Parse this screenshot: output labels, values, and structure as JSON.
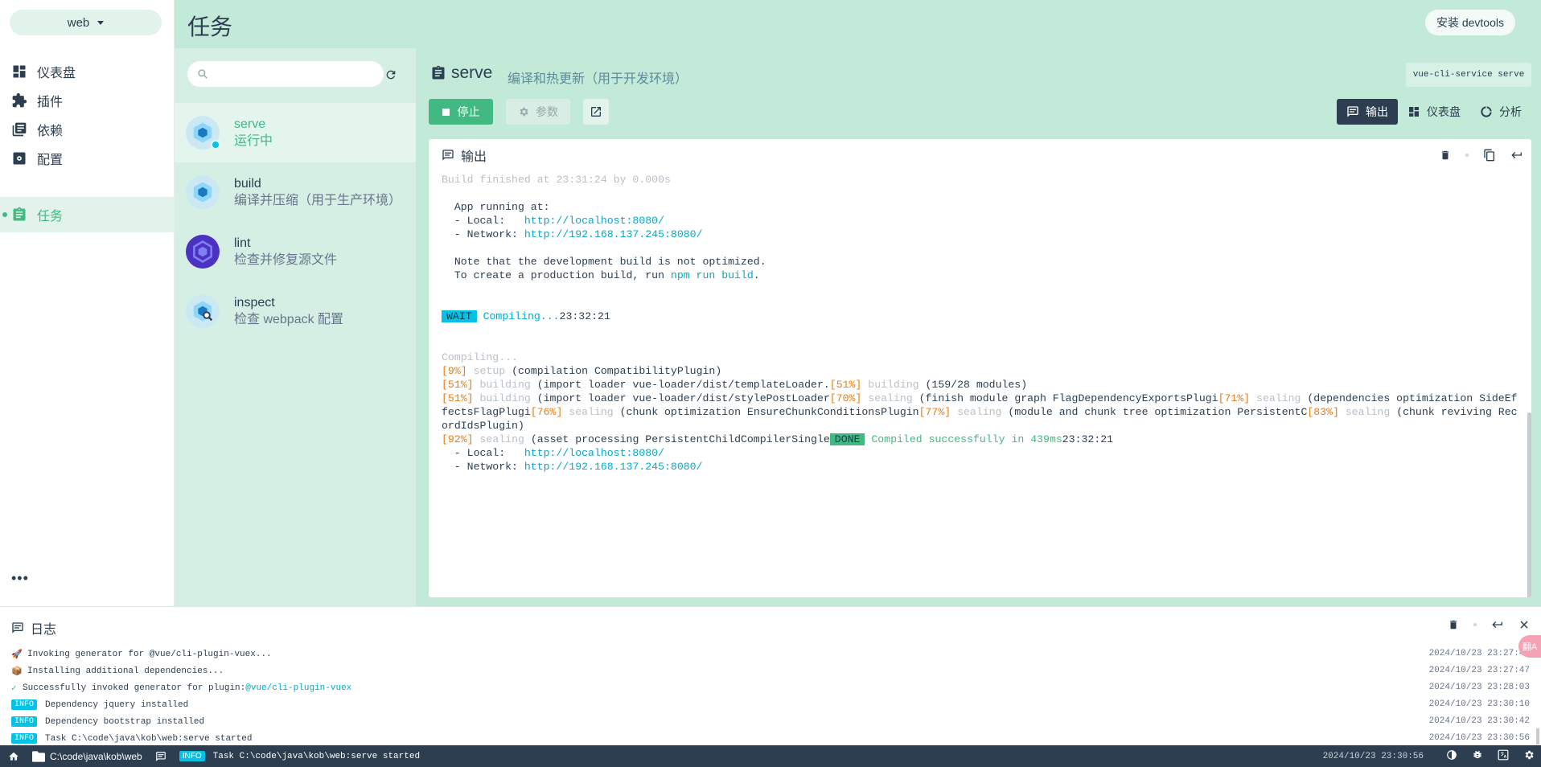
{
  "app": {
    "project": "web",
    "page_title": "任务",
    "devtools_label": "安装 devtools"
  },
  "nav": {
    "items": [
      {
        "label": "仪表盘",
        "icon": "dashboard-icon"
      },
      {
        "label": "插件",
        "icon": "puzzle-icon"
      },
      {
        "label": "依赖",
        "icon": "library-icon"
      },
      {
        "label": "配置",
        "icon": "settings-icon"
      },
      {
        "label": "任务",
        "icon": "assignment-icon",
        "active": true
      }
    ],
    "more": "•••"
  },
  "search": {
    "placeholder": "",
    "value": ""
  },
  "tasks": [
    {
      "name": "serve",
      "desc": "运行中",
      "selected": true
    },
    {
      "name": "build",
      "desc": "编译并压缩（用于生产环境）"
    },
    {
      "name": "lint",
      "desc": "检查并修复源文件"
    },
    {
      "name": "inspect",
      "desc": "检查 webpack 配置"
    }
  ],
  "detail": {
    "title": "serve",
    "desc": "编译和热更新（用于开发环境）",
    "command": "vue-cli-service serve",
    "stop_label": "停止",
    "params_label": "参数",
    "views": [
      {
        "label": "输出",
        "active": true
      },
      {
        "label": "仪表盘"
      },
      {
        "label": "分析"
      }
    ],
    "output_title": "输出"
  },
  "terminal": {
    "build_finished": "Build finished at 23:31:24 by 0.000s",
    "app_running": "App running at:",
    "local_label": "- Local:   ",
    "local_url": "http://localhost:8080/",
    "network_label": "- Network: ",
    "network_url": "http://192.168.137.245:8080/",
    "note1": "Note that the development build is not optimized.",
    "note2_pre": "To create a production build, run ",
    "note2_cmd": "npm run build",
    "note2_post": ".",
    "wait_tag": "WAIT",
    "compiling_text": "Compiling...",
    "compiling_time": "23:32:21",
    "compiling_dim": "Compiling...",
    "p9_pct": "[9%]",
    "p9_stage": "setup",
    "p9_rest": "(compilation CompatibilityPlugin)",
    "p51a_pct": "[51%]",
    "p51a_stage": "building",
    "p51a_rest": "(import loader vue-loader/dist/templateLoader.",
    "p51a_pct2": "[51%]",
    "p51a_stage2": "building",
    "p51a_rest2": "(159/28 modules)",
    "p51b_pct": "[51%]",
    "p51b_stage": "building",
    "p51b_rest": "(import loader vue-loader/dist/stylePostLoader",
    "p70_pct": "[70%]",
    "p70_stage": "sealing",
    "p70_rest": "(finish module graph FlagDependencyExportsPlugi",
    "p71_pct": "[71%]",
    "p71_stage": "sealing",
    "p71_rest": "(dependencies optimization SideEffectsFlagPlugi",
    "p76_pct": "[76%]",
    "p76_stage": "sealing",
    "p76_rest": "(chunk optimization EnsureChunkConditionsPlugin",
    "p77_pct": "[77%]",
    "p77_stage": "sealing",
    "p77_rest": "(module and chunk tree optimization PersistentC",
    "p83_pct": "[83%]",
    "p83_stage": "sealing",
    "p83_rest": "(chunk reviving RecordIdsPlugin)",
    "p92_pct": "[92%]",
    "p92_stage": "sealing",
    "p92_rest": "(asset processing PersistentChildCompilerSingle",
    "done_tag": "DONE",
    "done_text": "Compiled successfully in 439ms",
    "done_time": "23:32:21"
  },
  "log": {
    "title": "日志",
    "lines": [
      {
        "glyph": "🚀",
        "text": "Invoking generator for @vue/cli-plugin-vuex...",
        "time": "2024/10/23 23:27:47"
      },
      {
        "glyph": "📦",
        "text": "Installing additional dependencies...",
        "time": "2024/10/23 23:27:47"
      },
      {
        "glyph": "✓",
        "text": "Successfully invoked generator for plugin: ",
        "link": "@vue/cli-plugin-vuex",
        "time": "2024/10/23 23:28:03"
      },
      {
        "tag": "INFO",
        "text": "Dependency jquery installed",
        "time": "2024/10/23 23:30:10"
      },
      {
        "tag": "INFO",
        "text": "Dependency bootstrap installed",
        "time": "2024/10/23 23:30:42"
      },
      {
        "tag": "INFO",
        "text": "Task C:\\code\\java\\kob\\web:serve started",
        "time": "2024/10/23 23:30:56"
      }
    ]
  },
  "status_bar": {
    "path": "C:\\code\\java\\kob\\web",
    "info_tag": "INFO",
    "message": "Task C:\\code\\java\\kob\\web:serve started",
    "time": "2024/10/23 23:30:56"
  },
  "translate_badge": "翻A",
  "colors": {
    "accent": "#42b983",
    "header": "#c3e9d8",
    "dark": "#2c3e50",
    "info": "#03c2e6"
  }
}
